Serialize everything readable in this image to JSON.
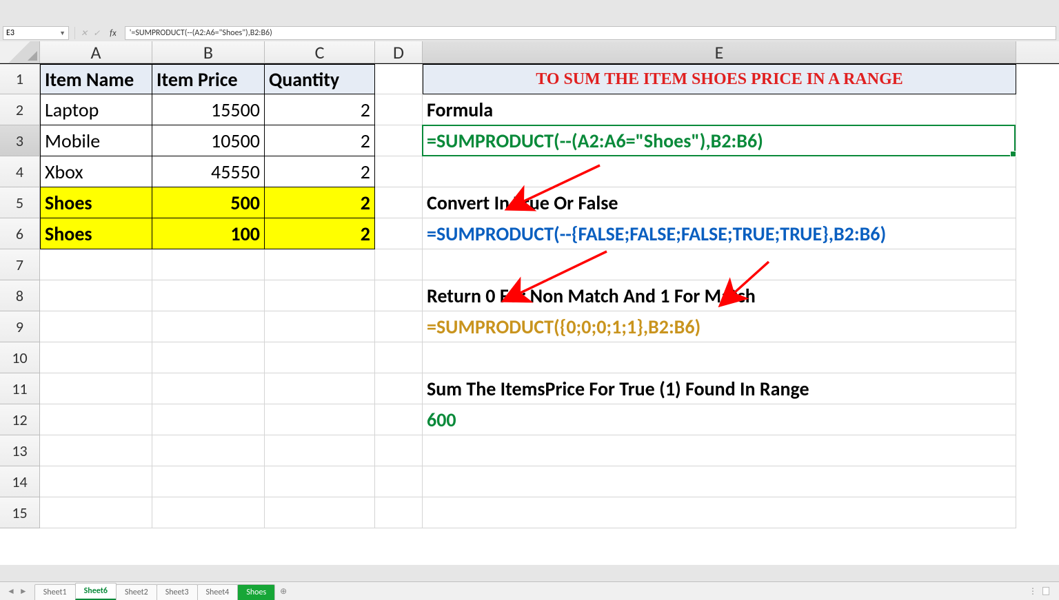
{
  "nameBox": "E3",
  "formulaBarText": "'=SUMPRODUCT(--(A2:A6=\"Shoes\"),B2:B6)",
  "columns": [
    "A",
    "B",
    "C",
    "D",
    "E"
  ],
  "rowCount": 15,
  "table": {
    "headers": {
      "a": "Item Name",
      "b": "Item Price",
      "c": "Quantity"
    },
    "rows": [
      {
        "a": "Laptop",
        "b": "15500",
        "c": "2",
        "yellow": false
      },
      {
        "a": "Mobile",
        "b": "10500",
        "c": "2",
        "yellow": false
      },
      {
        "a": "Xbox",
        "b": "45550",
        "c": "2",
        "yellow": false
      },
      {
        "a": "Shoes",
        "b": "500",
        "c": "2",
        "yellow": true
      },
      {
        "a": "Shoes",
        "b": "100",
        "c": "2",
        "yellow": true
      }
    ]
  },
  "eCol": {
    "1": {
      "text": "TO SUM THE ITEM SHOES PRICE IN A RANGE",
      "cls": "title-cell"
    },
    "2": {
      "text": "Formula",
      "cls": "black-bold"
    },
    "3": {
      "text": "=SUMPRODUCT(--(A2:A6=\"Shoes\"),B2:B6)",
      "cls": "green-txt"
    },
    "5": {
      "text": "Convert In True Or False",
      "cls": "black-bold"
    },
    "6": {
      "text": "=SUMPRODUCT(--{FALSE;FALSE;FALSE;TRUE;TRUE},B2:B6)",
      "cls": "blue-txt"
    },
    "8": {
      "text": "Return 0 For Non Match And 1 For Match",
      "cls": "black-bold"
    },
    "9": {
      "text": "=SUMPRODUCT({0;0;0;1;1},B2:B6)",
      "cls": "gold-txt"
    },
    "11": {
      "text": "Sum The ItemsPrice For True (1) Found In Range",
      "cls": "black-bold"
    },
    "12": {
      "text": "600",
      "cls": "green-txt"
    }
  },
  "selectedCell": "E3",
  "sheetTabs": [
    {
      "label": "Sheet1",
      "state": "normal"
    },
    {
      "label": "Sheet6",
      "state": "active"
    },
    {
      "label": "Sheet2",
      "state": "normal"
    },
    {
      "label": "Sheet3",
      "state": "normal"
    },
    {
      "label": "Sheet4",
      "state": "normal"
    },
    {
      "label": "Shoes",
      "state": "color"
    }
  ],
  "colors": {
    "accentGreen": "#0a8a3a",
    "highlightYellow": "#ffff00",
    "arrowRed": "#ff0000"
  }
}
